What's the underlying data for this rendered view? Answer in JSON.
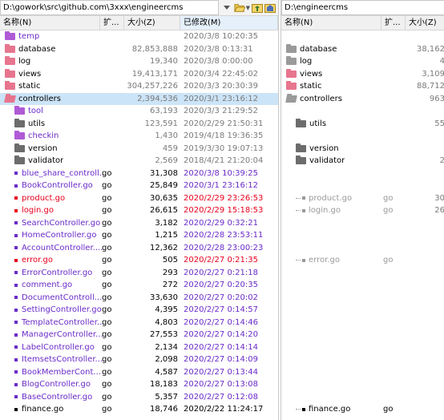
{
  "left": {
    "path": "D:\\gowork\\src\\github.com\\3xxx\\engineercms",
    "columns": {
      "name": "名称(N)",
      "ext": "扩...",
      "size": "大小(Z)",
      "modified": "已修改(M)"
    },
    "rows": [
      {
        "name": "temp",
        "ext": "",
        "size": "",
        "modified": "2020/3/8 10:20:35",
        "icon": "folder",
        "color": "#6a2bc9",
        "iconColor": "#b05bd6"
      },
      {
        "name": "database",
        "ext": "",
        "size": "82,853,888",
        "modified": "2020/3/8 0:13:31",
        "icon": "folder",
        "color": "#000000",
        "iconColor": "#e7758e"
      },
      {
        "name": "log",
        "ext": "",
        "size": "19,340",
        "modified": "2020/3/8 0:00:00",
        "icon": "folder",
        "color": "#000000",
        "iconColor": "#e7758e"
      },
      {
        "name": "views",
        "ext": "",
        "size": "19,413,171",
        "modified": "2020/3/4 22:45:02",
        "icon": "folder",
        "color": "#000000",
        "iconColor": "#e7758e"
      },
      {
        "name": "static",
        "ext": "",
        "size": "304,257,226",
        "modified": "2020/3/3 20:30:39",
        "icon": "folder",
        "color": "#000000",
        "iconColor": "#e7758e"
      },
      {
        "name": "controllers",
        "ext": "",
        "size": "2,394,536",
        "modified": "2020/3/1 23:16:12",
        "icon": "folder-open",
        "color": "#000000",
        "iconColor": "#e7758e",
        "selected": true
      },
      {
        "name": "tool",
        "ext": "",
        "size": "63,193",
        "modified": "2020/3/3 21:29:52",
        "icon": "folder",
        "color": "#6a2bc9",
        "iconColor": "#b05bd6",
        "indent": 1
      },
      {
        "name": "utils",
        "ext": "",
        "size": "123,591",
        "modified": "2020/2/29 21:50:31",
        "icon": "folder",
        "color": "#000000",
        "iconColor": "#6c6c6c",
        "indent": 1
      },
      {
        "name": "checkin",
        "ext": "",
        "size": "1,430",
        "modified": "2019/4/18 19:36:35",
        "icon": "folder",
        "color": "#6a2bc9",
        "iconColor": "#b05bd6",
        "indent": 1
      },
      {
        "name": "version",
        "ext": "",
        "size": "459",
        "modified": "2019/3/30 19:07:13",
        "icon": "folder",
        "color": "#000000",
        "iconColor": "#6c6c6c",
        "indent": 1
      },
      {
        "name": "validator",
        "ext": "",
        "size": "2,569",
        "modified": "2018/4/21 21:20:04",
        "icon": "folder",
        "color": "#000000",
        "iconColor": "#6c6c6c",
        "indent": 1
      },
      {
        "name": "blue_share_controll...",
        "ext": "go",
        "size": "31,308",
        "modified": "2020/3/8 10:39:25",
        "icon": "file",
        "color": "#6a2bc9",
        "iconColor": "#6a2bc9",
        "indent": 1,
        "strong": true
      },
      {
        "name": "BookController.go",
        "ext": "go",
        "size": "25,849",
        "modified": "2020/3/1 23:16:12",
        "icon": "file",
        "color": "#6a2bc9",
        "iconColor": "#6a2bc9",
        "indent": 1,
        "strong": true
      },
      {
        "name": "product.go",
        "ext": "go",
        "size": "30,635",
        "modified": "2020/2/29 23:26:53",
        "icon": "file",
        "color": "#e8001c",
        "iconColor": "#e8001c",
        "indent": 1,
        "strong": true
      },
      {
        "name": "login.go",
        "ext": "go",
        "size": "26,615",
        "modified": "2020/2/29 15:18:53",
        "icon": "file",
        "color": "#e8001c",
        "iconColor": "#e8001c",
        "indent": 1,
        "strong": true
      },
      {
        "name": "SearchController.go",
        "ext": "go",
        "size": "3,182",
        "modified": "2020/2/29 0:32:21",
        "icon": "file",
        "color": "#6a2bc9",
        "iconColor": "#6a2bc9",
        "indent": 1,
        "strong": true
      },
      {
        "name": "HomeController.go",
        "ext": "go",
        "size": "1,215",
        "modified": "2020/2/28 23:53:11",
        "icon": "file",
        "color": "#6a2bc9",
        "iconColor": "#6a2bc9",
        "indent": 1,
        "strong": true
      },
      {
        "name": "AccountController....",
        "ext": "go",
        "size": "12,362",
        "modified": "2020/2/28 23:00:23",
        "icon": "file",
        "color": "#6a2bc9",
        "iconColor": "#6a2bc9",
        "indent": 1,
        "strong": true
      },
      {
        "name": "error.go",
        "ext": "go",
        "size": "505",
        "modified": "2020/2/27 0:21:35",
        "icon": "file",
        "color": "#e8001c",
        "iconColor": "#e8001c",
        "indent": 1,
        "strong": true
      },
      {
        "name": "ErrorController.go",
        "ext": "go",
        "size": "293",
        "modified": "2020/2/27 0:21:18",
        "icon": "file",
        "color": "#6a2bc9",
        "iconColor": "#6a2bc9",
        "indent": 1,
        "strong": true
      },
      {
        "name": "comment.go",
        "ext": "go",
        "size": "272",
        "modified": "2020/2/27 0:20:35",
        "icon": "file",
        "color": "#6a2bc9",
        "iconColor": "#6a2bc9",
        "indent": 1,
        "strong": true
      },
      {
        "name": "DocumentControll...",
        "ext": "go",
        "size": "33,630",
        "modified": "2020/2/27 0:20:02",
        "icon": "file",
        "color": "#6a2bc9",
        "iconColor": "#6a2bc9",
        "indent": 1,
        "strong": true
      },
      {
        "name": "SettingController.go",
        "ext": "go",
        "size": "4,395",
        "modified": "2020/2/27 0:14:57",
        "icon": "file",
        "color": "#6a2bc9",
        "iconColor": "#6a2bc9",
        "indent": 1,
        "strong": true
      },
      {
        "name": "TemplateController...",
        "ext": "go",
        "size": "4,803",
        "modified": "2020/2/27 0:14:46",
        "icon": "file",
        "color": "#6a2bc9",
        "iconColor": "#6a2bc9",
        "indent": 1,
        "strong": true
      },
      {
        "name": "ManagerController...",
        "ext": "go",
        "size": "27,553",
        "modified": "2020/2/27 0:14:20",
        "icon": "file",
        "color": "#6a2bc9",
        "iconColor": "#6a2bc9",
        "indent": 1,
        "strong": true
      },
      {
        "name": "LabelController.go",
        "ext": "go",
        "size": "2,134",
        "modified": "2020/2/27 0:14:14",
        "icon": "file",
        "color": "#6a2bc9",
        "iconColor": "#6a2bc9",
        "indent": 1,
        "strong": true
      },
      {
        "name": "ItemsetsController....",
        "ext": "go",
        "size": "2,098",
        "modified": "2020/2/27 0:14:09",
        "icon": "file",
        "color": "#6a2bc9",
        "iconColor": "#6a2bc9",
        "indent": 1,
        "strong": true
      },
      {
        "name": "BookMemberCont...",
        "ext": "go",
        "size": "4,587",
        "modified": "2020/2/27 0:13:44",
        "icon": "file",
        "color": "#6a2bc9",
        "iconColor": "#6a2bc9",
        "indent": 1,
        "strong": true
      },
      {
        "name": "BlogController.go",
        "ext": "go",
        "size": "18,183",
        "modified": "2020/2/27 0:13:08",
        "icon": "file",
        "color": "#6a2bc9",
        "iconColor": "#6a2bc9",
        "indent": 1,
        "strong": true
      },
      {
        "name": "BaseController.go",
        "ext": "go",
        "size": "5,357",
        "modified": "2020/2/27 0:12:08",
        "icon": "file",
        "color": "#6a2bc9",
        "iconColor": "#6a2bc9",
        "indent": 1,
        "strong": true
      },
      {
        "name": "finance.go",
        "ext": "go",
        "size": "18,746",
        "modified": "2020/2/22 11:24:17",
        "icon": "file",
        "color": "#000000",
        "iconColor": "#000000",
        "indent": 1,
        "strong": true
      }
    ]
  },
  "right": {
    "path": "D:\\engineercms",
    "columns": {
      "name": "名称(N)",
      "ext": "扩...",
      "size": "大小(Z)"
    },
    "rows": [
      {
        "name": "",
        "ext": "",
        "size": "",
        "icon": "none"
      },
      {
        "name": "database",
        "ext": "",
        "size": "38,162",
        "icon": "folder",
        "color": "#000000",
        "iconColor": "#9a9a9a"
      },
      {
        "name": "log",
        "ext": "",
        "size": "4",
        "icon": "folder",
        "color": "#000000",
        "iconColor": "#9a9a9a"
      },
      {
        "name": "views",
        "ext": "",
        "size": "3,109",
        "icon": "folder",
        "color": "#000000",
        "iconColor": "#e7758e"
      },
      {
        "name": "static",
        "ext": "",
        "size": "88,712",
        "icon": "folder",
        "color": "#000000",
        "iconColor": "#e7758e"
      },
      {
        "name": "controllers",
        "ext": "",
        "size": "963",
        "icon": "folder-open",
        "color": "#000000",
        "iconColor": "#9a9a9a"
      },
      {
        "name": "",
        "ext": "",
        "size": "",
        "icon": "none"
      },
      {
        "name": "utils",
        "ext": "",
        "size": "55",
        "icon": "folder",
        "color": "#000000",
        "iconColor": "#6c6c6c",
        "indent": 1
      },
      {
        "name": "",
        "ext": "",
        "size": "",
        "icon": "none"
      },
      {
        "name": "version",
        "ext": "",
        "size": "",
        "icon": "folder",
        "color": "#000000",
        "iconColor": "#6c6c6c",
        "indent": 1
      },
      {
        "name": "validator",
        "ext": "",
        "size": "2",
        "icon": "folder",
        "color": "#000000",
        "iconColor": "#6c6c6c",
        "indent": 1
      },
      {
        "name": "",
        "ext": "",
        "size": "",
        "icon": "none"
      },
      {
        "name": "",
        "ext": "",
        "size": "",
        "icon": "none"
      },
      {
        "name": "product.go",
        "ext": "go",
        "size": "30",
        "icon": "ghost",
        "color": "#9a9a9a",
        "indent": 1
      },
      {
        "name": "login.go",
        "ext": "go",
        "size": "26",
        "icon": "ghost",
        "color": "#9a9a9a",
        "indent": 1
      },
      {
        "name": "",
        "ext": "",
        "size": "",
        "icon": "none"
      },
      {
        "name": "",
        "ext": "",
        "size": "",
        "icon": "none"
      },
      {
        "name": "",
        "ext": "",
        "size": "",
        "icon": "none"
      },
      {
        "name": "error.go",
        "ext": "go",
        "size": "",
        "icon": "ghost",
        "color": "#9a9a9a",
        "indent": 1
      },
      {
        "name": "",
        "ext": "",
        "size": "",
        "icon": "none"
      },
      {
        "name": "",
        "ext": "",
        "size": "",
        "icon": "none"
      },
      {
        "name": "",
        "ext": "",
        "size": "",
        "icon": "none"
      },
      {
        "name": "",
        "ext": "",
        "size": "",
        "icon": "none"
      },
      {
        "name": "",
        "ext": "",
        "size": "",
        "icon": "none"
      },
      {
        "name": "",
        "ext": "",
        "size": "",
        "icon": "none"
      },
      {
        "name": "",
        "ext": "",
        "size": "",
        "icon": "none"
      },
      {
        "name": "",
        "ext": "",
        "size": "",
        "icon": "none"
      },
      {
        "name": "",
        "ext": "",
        "size": "",
        "icon": "none"
      },
      {
        "name": "",
        "ext": "",
        "size": "",
        "icon": "none"
      },
      {
        "name": "",
        "ext": "",
        "size": "",
        "icon": "none"
      },
      {
        "name": "finance.go",
        "ext": "go",
        "size": "",
        "icon": "ghost-file",
        "color": "#000000",
        "indent": 1
      }
    ]
  },
  "toolbar": {
    "icons": [
      "dropdown-icon",
      "open-folder-icon",
      "up-folder-icon",
      "home-folder-icon"
    ]
  }
}
